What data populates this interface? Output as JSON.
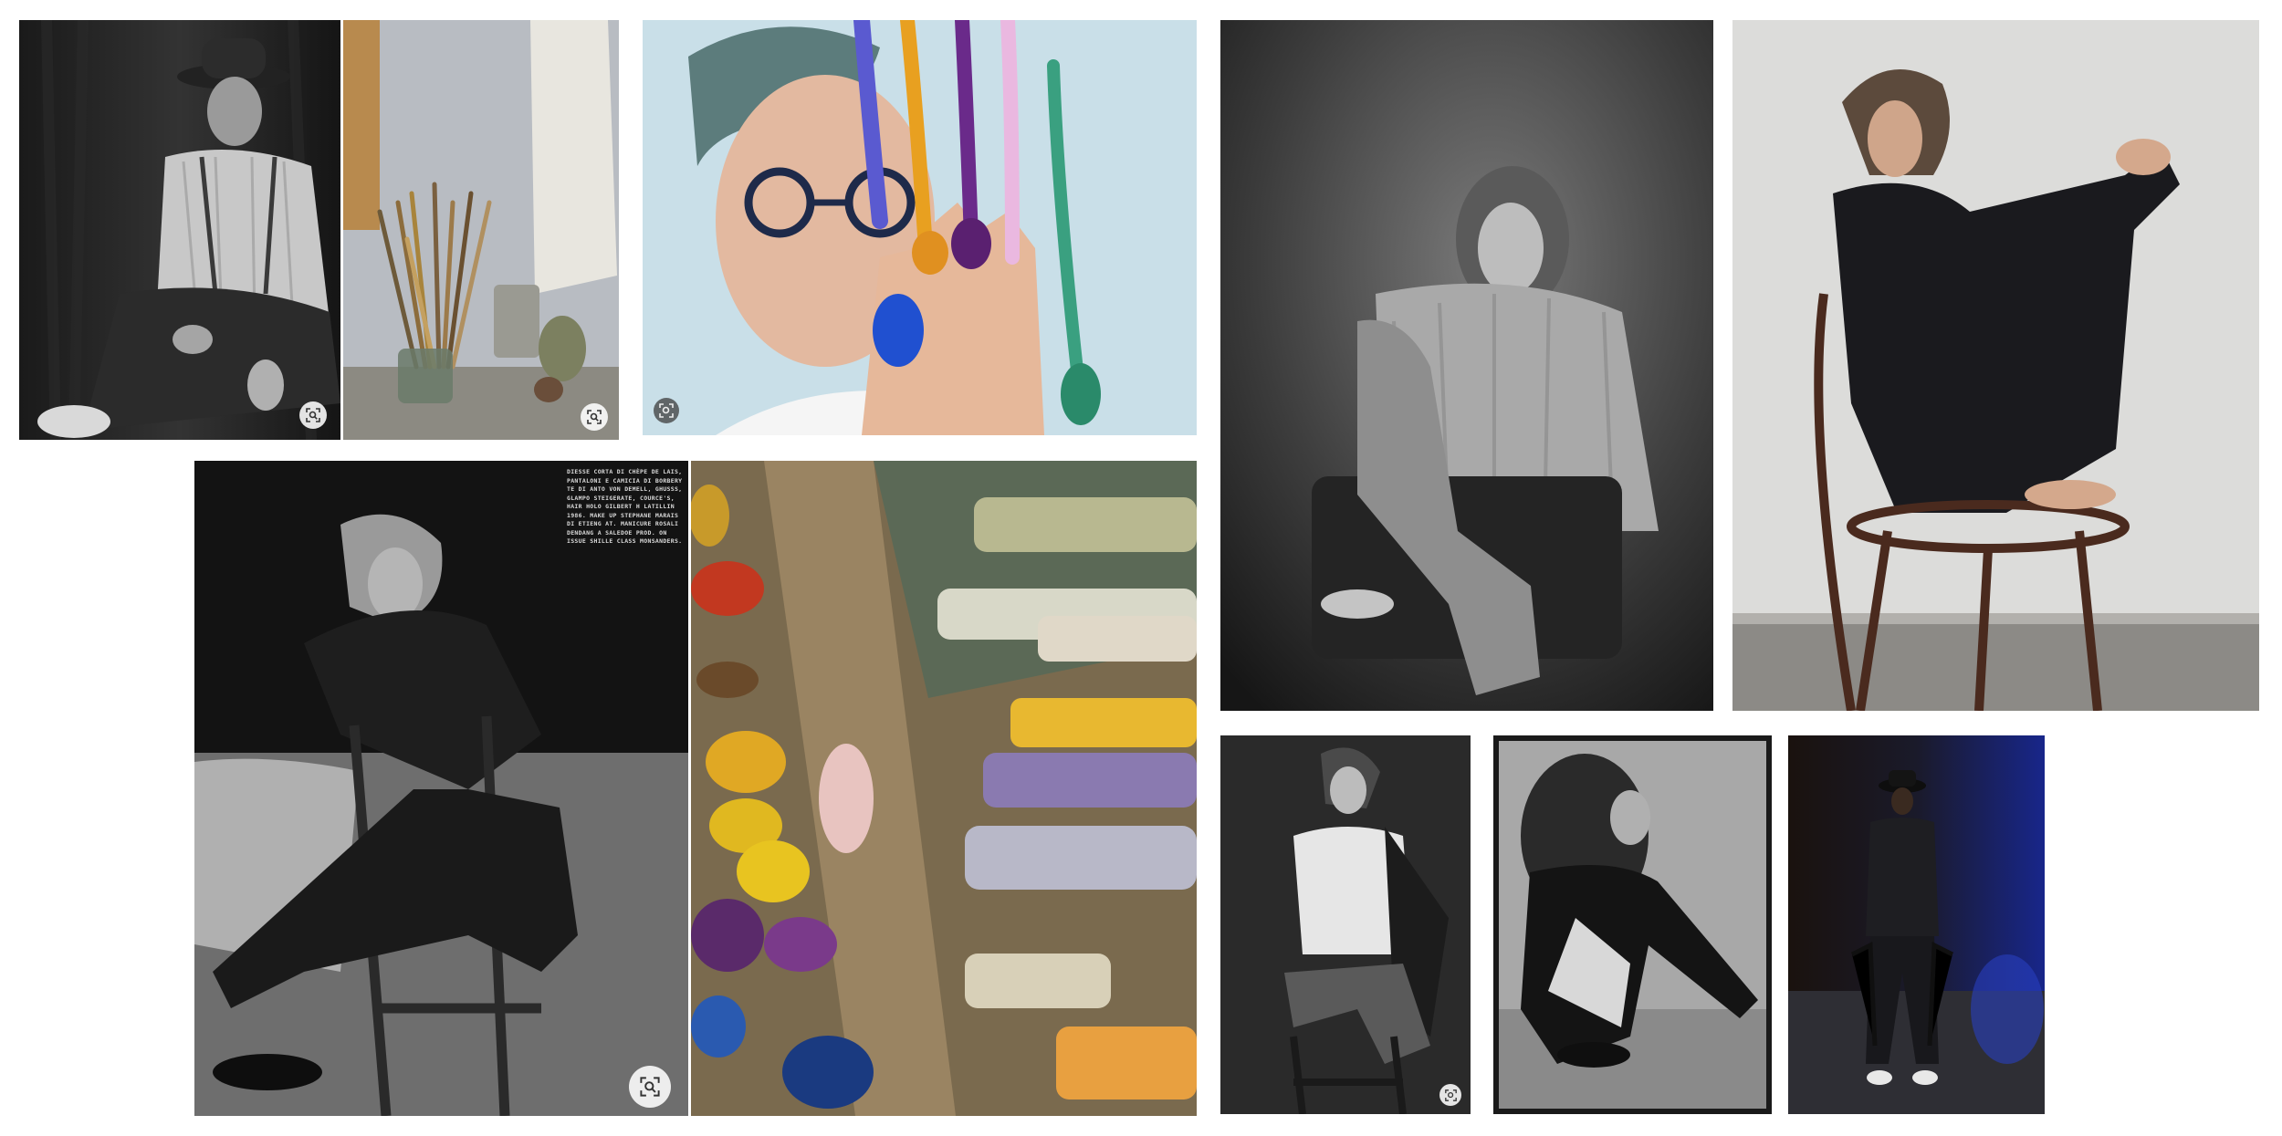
{
  "gallery": {
    "tiles": [
      {
        "name": "bw-man-in-hat-portrait",
        "lens": true
      },
      {
        "name": "paint-brushes-still-life",
        "lens": true
      },
      {
        "name": "painted-fingers-portrait",
        "lens": true
      },
      {
        "name": "woman-in-sweater-on-chair",
        "lens": false
      },
      {
        "name": "woman-in-black-on-bentwood-chair",
        "lens": false
      },
      {
        "name": "bw-woman-leaning-on-chair",
        "lens": true
      },
      {
        "name": "oil-paint-palette-tubes",
        "lens": false
      },
      {
        "name": "woman-seated-on-stool",
        "lens": true
      },
      {
        "name": "woman-with-curly-hair-crouching",
        "lens": false
      },
      {
        "name": "man-in-hat-blue-backdrop",
        "lens": false
      }
    ],
    "magazine_caption": "DIESSE CORTA DI CHÈPE DE LAIS,\nPANTALONI E CAMICIA DI BORBERY\nTE DI ANTO VON DEMELL, GHUSSS,\nGLAMPO STEIGERATE, COURCE'S,\nHAIR HOLO GILBERT H LATILLIN\n1986. MAKE UP STEPHANE MARAIS\nDI ETIENG AT. MANICURE ROSALI\nDENDANG A SALEDOE PROD. ON\nISSUE SHILLE CLASS MONSANDERS.",
    "lens_icon": "visual-search-icon"
  }
}
